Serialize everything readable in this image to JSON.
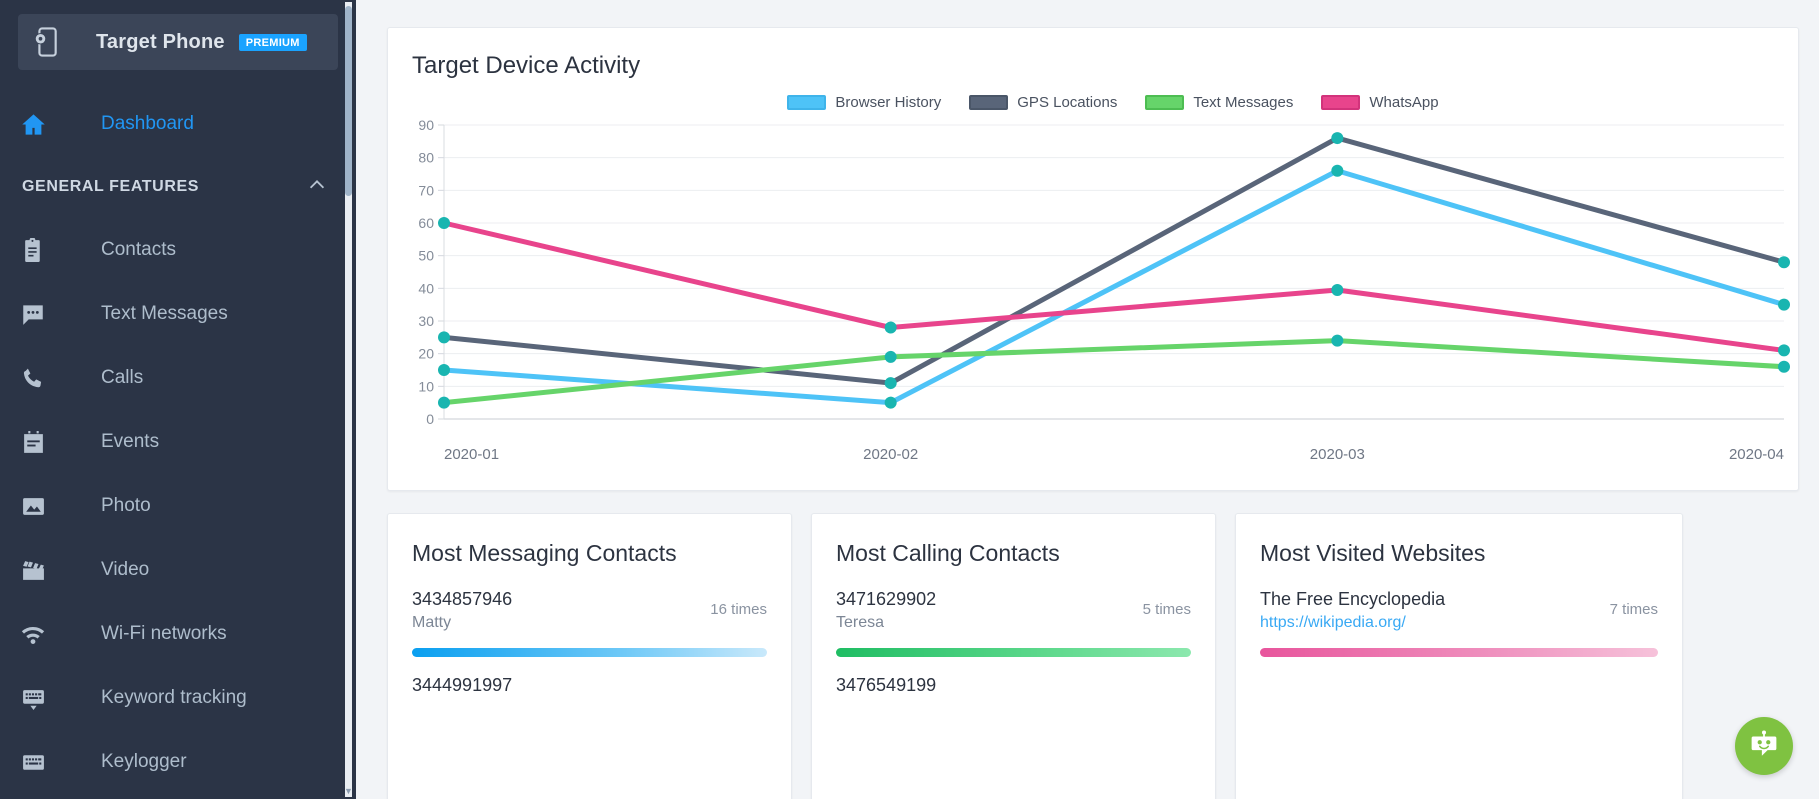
{
  "sidebar": {
    "device": {
      "name": "Target Phone",
      "badge": "PREMIUM",
      "icon": "phone-settings-icon"
    },
    "dashboard": {
      "label": "Dashboard",
      "icon": "home-icon"
    },
    "section": {
      "label": "GENERAL FEATURES",
      "chevron": "chevron-up-icon"
    },
    "items": [
      {
        "label": "Contacts",
        "icon": "contacts-icon"
      },
      {
        "label": "Text Messages",
        "icon": "message-icon"
      },
      {
        "label": "Calls",
        "icon": "phone-icon"
      },
      {
        "label": "Events",
        "icon": "calendar-icon"
      },
      {
        "label": "Photo",
        "icon": "image-icon"
      },
      {
        "label": "Video",
        "icon": "clapperboard-icon"
      },
      {
        "label": "Wi-Fi networks",
        "icon": "wifi-icon"
      },
      {
        "label": "Keyword tracking",
        "icon": "keyboard-down-icon"
      },
      {
        "label": "Keylogger",
        "icon": "keyboard-icon"
      }
    ]
  },
  "chart_data": {
    "type": "line",
    "title": "Target Device Activity",
    "categories": [
      "2020-01",
      "2020-02",
      "2020-03",
      "2020-04"
    ],
    "series": [
      {
        "name": "Browser History",
        "color": "#4ec3f7",
        "values": [
          15,
          5,
          76,
          35
        ]
      },
      {
        "name": "GPS Locations",
        "color": "#596579",
        "values": [
          25,
          11,
          86,
          48
        ]
      },
      {
        "name": "Text Messages",
        "color": "#66d46a",
        "values": [
          5,
          19,
          24,
          16
        ]
      },
      {
        "name": "WhatsApp",
        "color": "#e8448c",
        "values": [
          60,
          28,
          39.5,
          21
        ]
      }
    ],
    "ylim": [
      0,
      90
    ],
    "yticks": [
      0,
      10,
      20,
      30,
      40,
      50,
      60,
      70,
      80,
      90
    ],
    "xlabel": "",
    "ylabel": "",
    "grid": true,
    "legend_position": "top-center",
    "marker_color": "#19b5b0"
  },
  "cards": [
    {
      "title": "Most Messaging Contacts",
      "entries": [
        {
          "primary": "3434857946",
          "secondary": "Matty",
          "count": "16 times",
          "bar_pct": 100,
          "bar_style": "bar-blue"
        },
        {
          "primary": "3444991997",
          "secondary": "",
          "count": "",
          "bar_pct": 0,
          "bar_style": "bar-blue"
        }
      ]
    },
    {
      "title": "Most Calling Contacts",
      "entries": [
        {
          "primary": "3471629902",
          "secondary": "Teresa",
          "count": "5 times",
          "bar_pct": 100,
          "bar_style": "bar-green"
        },
        {
          "primary": "3476549199",
          "secondary": "",
          "count": "",
          "bar_pct": 0,
          "bar_style": "bar-green"
        }
      ]
    },
    {
      "title": "Most Visited Websites",
      "entries": [
        {
          "primary": "The Free Encyclopedia",
          "secondary": "https://wikipedia.org/",
          "count": "7 times",
          "bar_pct": 100,
          "bar_style": "bar-pink"
        }
      ]
    }
  ],
  "chat": {
    "icon": "chat-bot-icon",
    "color": "#7fc241"
  }
}
